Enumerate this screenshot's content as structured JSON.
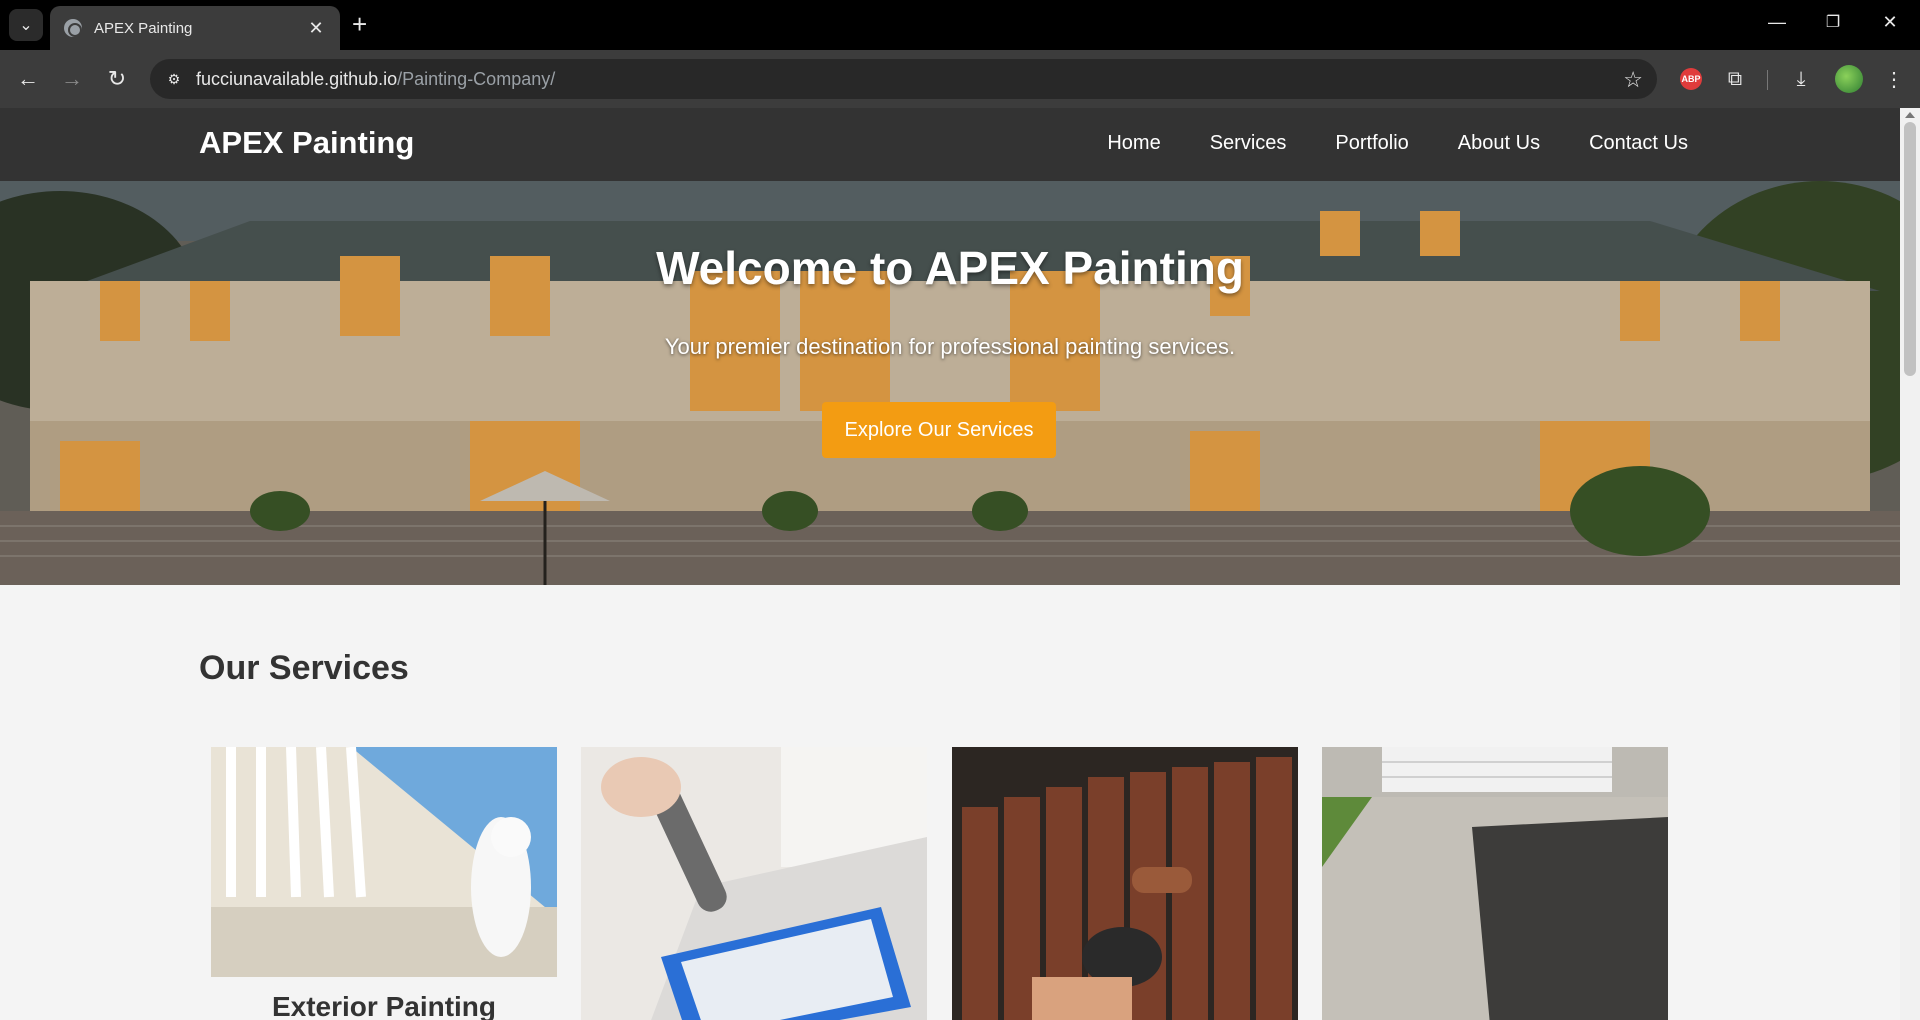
{
  "browser": {
    "tab_title": "APEX Painting",
    "url_host": "fucciunavailable.github.io",
    "url_path": "/Painting-Company/",
    "extensions": {
      "abp_label": "ABP"
    }
  },
  "site": {
    "logo": "APEX Painting",
    "nav": [
      "Home",
      "Services",
      "Portfolio",
      "About Us",
      "Contact Us"
    ]
  },
  "hero": {
    "title": "Welcome to APEX Painting",
    "subtitle": "Your premier destination for professional painting services.",
    "cta": "Explore Our Services"
  },
  "services": {
    "heading": "Our Services",
    "cards": [
      {
        "title": "Exterior Painting",
        "image": "exterior-painter-spraying-railing"
      },
      {
        "title": "",
        "image": "paint-roller-tray"
      },
      {
        "title": "",
        "image": "fence-staining"
      },
      {
        "title": "",
        "image": "driveway-sealing"
      }
    ]
  },
  "colors": {
    "header_bg": "#333333",
    "accent": "#f39c12",
    "page_bg": "#f4f4f4"
  }
}
